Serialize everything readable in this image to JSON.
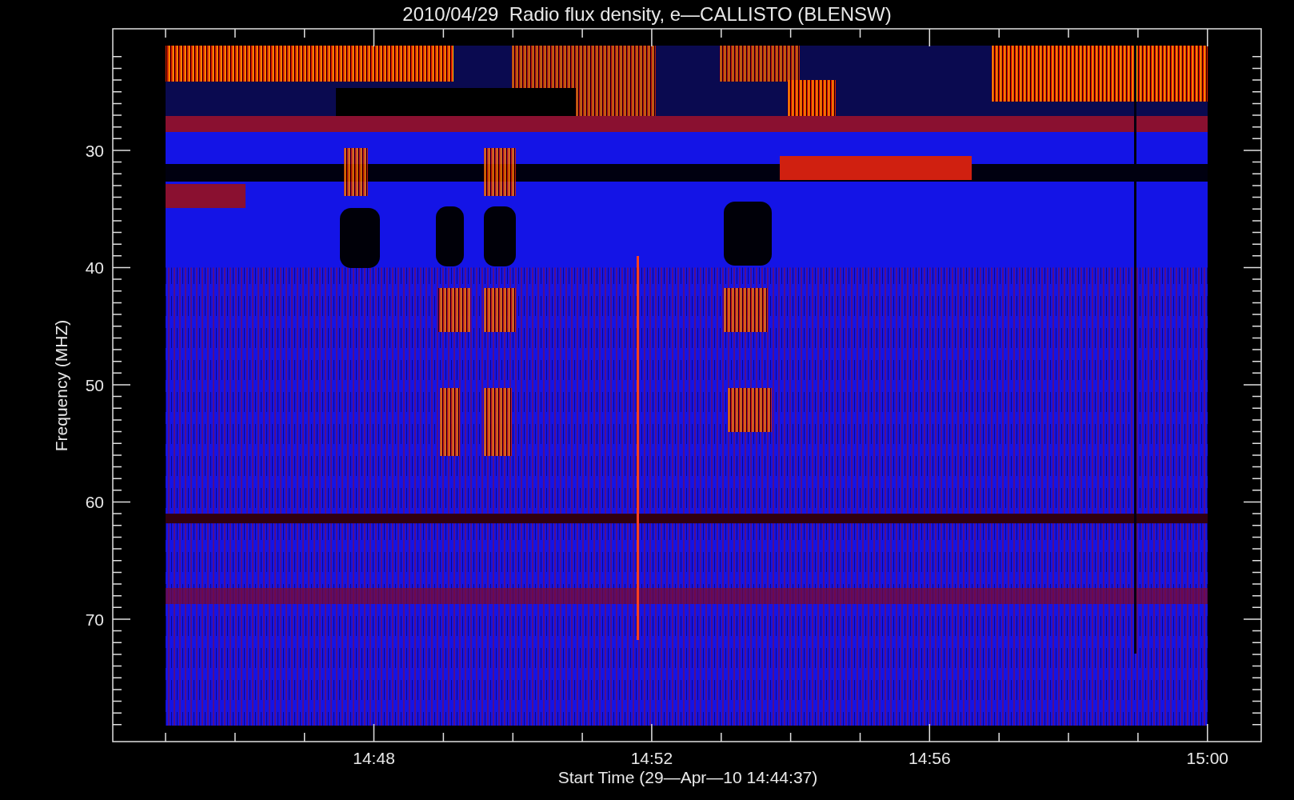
{
  "title": "2010/04/29  Radio flux density, e—CALLISTO (BLENSW)",
  "y_axis": {
    "title": "Frequency (MHZ)",
    "tick_labels": [
      "30",
      "40",
      "50",
      "60",
      "70"
    ]
  },
  "x_axis": {
    "title": "Start Time (29—Apr—10 14:44:37)",
    "tick_labels": [
      "14:48",
      "14:52",
      "14:56",
      "15:00"
    ]
  }
}
